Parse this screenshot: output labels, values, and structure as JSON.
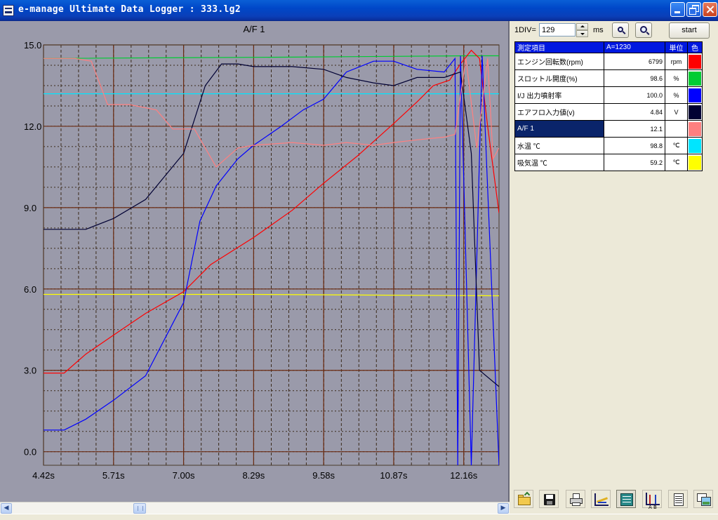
{
  "window": {
    "title": "e-manage Ultimate Data Logger : 333.lg2"
  },
  "controls": {
    "div_label": "1DIV=",
    "div_value": "129",
    "unit_label": "ms",
    "start_label": "start"
  },
  "table": {
    "headers": [
      "測定項目",
      "A=1230",
      "単位",
      "色"
    ],
    "rows": [
      {
        "name": "エンジン回転数(rpm)",
        "value": "6799",
        "unit": "rpm",
        "color": "#ff0000"
      },
      {
        "name": "スロットル開度(%)",
        "value": "98.6",
        "unit": "%",
        "color": "#00cc33"
      },
      {
        "name": "I/J 出力噴射率",
        "value": "100.0",
        "unit": "%",
        "color": "#0000ff"
      },
      {
        "name": "エアフロ入力値(v)",
        "value": "4.84",
        "unit": "V",
        "color": "#000033"
      },
      {
        "name": "A/F 1",
        "value": "12.1",
        "unit": "",
        "color": "#ff8080"
      },
      {
        "name": "水温 ℃",
        "value": "98.8",
        "unit": "℃",
        "color": "#00e5ff"
      },
      {
        "name": "吸気温 ℃",
        "value": "59.2",
        "unit": "℃",
        "color": "#ffff00"
      }
    ]
  },
  "chart_data": {
    "type": "line",
    "title": "A/F 1",
    "ylim": [
      -0.5,
      15.0
    ],
    "ytick_labels": [
      "15.0",
      "12.0",
      "9.0",
      "6.0",
      "3.0",
      "0.0"
    ],
    "ytick_values": [
      15.0,
      12.0,
      9.0,
      6.0,
      3.0,
      0.0
    ],
    "xtick_labels": [
      "4.42s",
      "5.71s",
      "7.00s",
      "8.29s",
      "9.58s",
      "10.87s",
      "12.16s"
    ],
    "xtick_values": [
      4.42,
      5.71,
      7.0,
      8.29,
      9.58,
      10.87,
      12.16
    ],
    "xlim": [
      4.42,
      12.81
    ],
    "grid": true,
    "series": [
      {
        "color": "#00cc33",
        "x": [
          4.42,
          9.0,
          12.2,
          12.3,
          12.35,
          12.4,
          12.81
        ],
        "y": [
          14.5,
          14.55,
          14.6,
          14.6,
          14.6,
          14.6,
          14.6
        ]
      },
      {
        "color": "#00e5ff",
        "x": [
          4.42,
          12.81
        ],
        "y": [
          13.2,
          13.2
        ]
      },
      {
        "color": "#ffff00",
        "x": [
          4.42,
          8.29,
          12.81
        ],
        "y": [
          5.8,
          5.8,
          5.75
        ]
      },
      {
        "color": "#ff0000",
        "x": [
          4.42,
          4.8,
          5.2,
          5.71,
          6.3,
          7.0,
          7.5,
          8.29,
          9.0,
          9.58,
          10.2,
          10.87,
          11.3,
          11.6,
          11.9,
          12.1,
          12.3,
          12.45,
          12.6,
          12.81
        ],
        "y": [
          2.9,
          2.9,
          3.6,
          4.3,
          5.1,
          5.9,
          6.9,
          7.9,
          8.9,
          9.9,
          10.9,
          12.1,
          12.9,
          13.5,
          13.7,
          14.3,
          14.8,
          14.5,
          12.0,
          8.8
        ]
      },
      {
        "color": "#0000ff",
        "x": [
          4.42,
          4.8,
          5.2,
          5.71,
          6.3,
          7.0,
          7.3,
          7.6,
          8.0,
          8.29,
          8.8,
          9.2,
          9.58,
          10.0,
          10.5,
          10.87,
          11.3,
          11.8,
          12.0,
          12.05,
          12.1,
          12.3,
          12.5,
          12.81
        ],
        "y": [
          0.8,
          0.8,
          1.2,
          1.9,
          2.8,
          5.5,
          8.5,
          9.8,
          10.8,
          11.3,
          12.0,
          12.6,
          13.0,
          14.0,
          14.4,
          14.4,
          14.1,
          14.0,
          14.5,
          -0.5,
          14.6,
          -0.5,
          14.6,
          -0.5
        ]
      },
      {
        "color": "#000033",
        "x": [
          4.42,
          5.2,
          5.71,
          6.3,
          7.0,
          7.4,
          7.7,
          8.0,
          8.29,
          9.0,
          9.58,
          10.0,
          10.5,
          10.87,
          11.3,
          11.8,
          12.1,
          12.3,
          12.45,
          12.81
        ],
        "y": [
          8.2,
          8.2,
          8.6,
          9.3,
          11.0,
          13.5,
          14.3,
          14.3,
          14.2,
          14.2,
          14.1,
          13.8,
          13.6,
          13.5,
          13.8,
          13.8,
          14.0,
          11.0,
          3.0,
          2.4
        ]
      },
      {
        "color": "#ff8080",
        "x": [
          4.42,
          5.0,
          5.3,
          5.6,
          6.0,
          6.5,
          6.8,
          7.2,
          7.6,
          8.0,
          8.29,
          9.0,
          9.58,
          10.0,
          10.5,
          10.87,
          11.3,
          11.8,
          12.0,
          12.2,
          12.4,
          12.6,
          12.7,
          12.81
        ],
        "y": [
          14.5,
          14.5,
          14.4,
          12.8,
          12.8,
          12.6,
          11.9,
          11.9,
          10.5,
          11.2,
          11.3,
          11.4,
          11.3,
          11.4,
          11.3,
          11.4,
          11.5,
          11.6,
          11.7,
          14.5,
          11.2,
          14.5,
          10.8,
          11.2
        ]
      }
    ]
  },
  "toolbar": {
    "icons": [
      "open-folder-icon",
      "save-icon",
      "print-icon",
      "graph-edit-icon",
      "list-view-icon",
      "ab-cursor-icon",
      "document-icon",
      "picture-icon"
    ]
  }
}
